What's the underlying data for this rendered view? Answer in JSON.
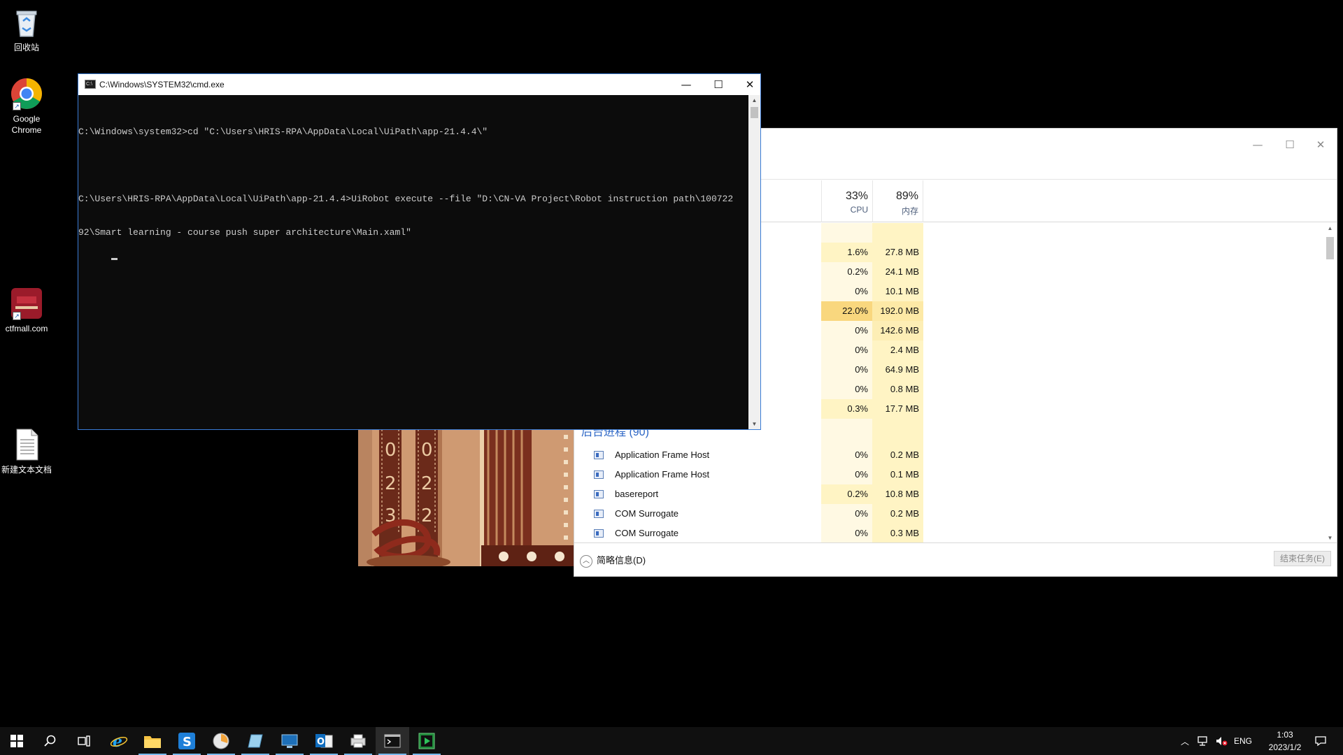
{
  "desktop": {
    "icons": [
      {
        "label": "回收站"
      },
      {
        "label": "Google Chrome"
      },
      {
        "label": "ctfmall.com"
      },
      {
        "label": "新建文本文档"
      }
    ],
    "wallpaper_digits": [
      "0",
      "2",
      "3",
      "0",
      "2",
      "2"
    ]
  },
  "cmd": {
    "title": "C:\\Windows\\SYSTEM32\\cmd.exe",
    "lines": [
      "C:\\Windows\\system32>cd \"C:\\Users\\HRIS-RPA\\AppData\\Local\\UiPath\\app-21.4.4\\\"",
      "C:\\Users\\HRIS-RPA\\AppData\\Local\\UiPath\\app-21.4.4>UiRobot execute --file \"D:\\CN-VA Project\\Robot instruction path\\100722",
      "92\\Smart learning - course push super architecture\\Main.xaml\""
    ]
  },
  "taskmgr": {
    "cpu_pct": "33%",
    "cpu_label": "CPU",
    "mem_pct": "89%",
    "mem_label": "内存",
    "app_rows": [
      {
        "cpu": "1.6%",
        "mem": "27.8 MB"
      },
      {
        "cpu": "0.2%",
        "mem": "24.1 MB"
      },
      {
        "cpu": "0%",
        "mem": "10.1 MB"
      },
      {
        "cpu": "22.0%",
        "mem": "192.0 MB"
      },
      {
        "cpu": "0%",
        "mem": "142.6 MB"
      },
      {
        "cpu": "0%",
        "mem": "2.4 MB"
      },
      {
        "cpu": "0%",
        "mem": "64.9 MB"
      },
      {
        "cpu": "0%",
        "mem": "0.8 MB"
      },
      {
        "cpu": "0.3%",
        "mem": "17.7 MB"
      }
    ],
    "background_group": "后台进程 (90)",
    "bg_rows": [
      {
        "name": "Application Frame Host",
        "cpu": "0%",
        "mem": "0.2 MB"
      },
      {
        "name": "Application Frame Host",
        "cpu": "0%",
        "mem": "0.1 MB"
      },
      {
        "name": "basereport",
        "cpu": "0.2%",
        "mem": "10.8 MB"
      },
      {
        "name": "COM Surrogate",
        "cpu": "0%",
        "mem": "0.2 MB"
      },
      {
        "name": "COM Surrogate",
        "cpu": "0%",
        "mem": "0.3 MB"
      }
    ],
    "fewer_details": "简略信息(D)",
    "end_task": "结束任务(E)"
  },
  "taskbar": {
    "tray_lang": "ENG",
    "time": "1:03",
    "date": "2023/1/2"
  },
  "colors": {
    "cpu_hot": "#f9d77e",
    "cell_light": "#fff4c4",
    "cell_lighter": "#fff9e3",
    "accent": "#76b9ed"
  }
}
